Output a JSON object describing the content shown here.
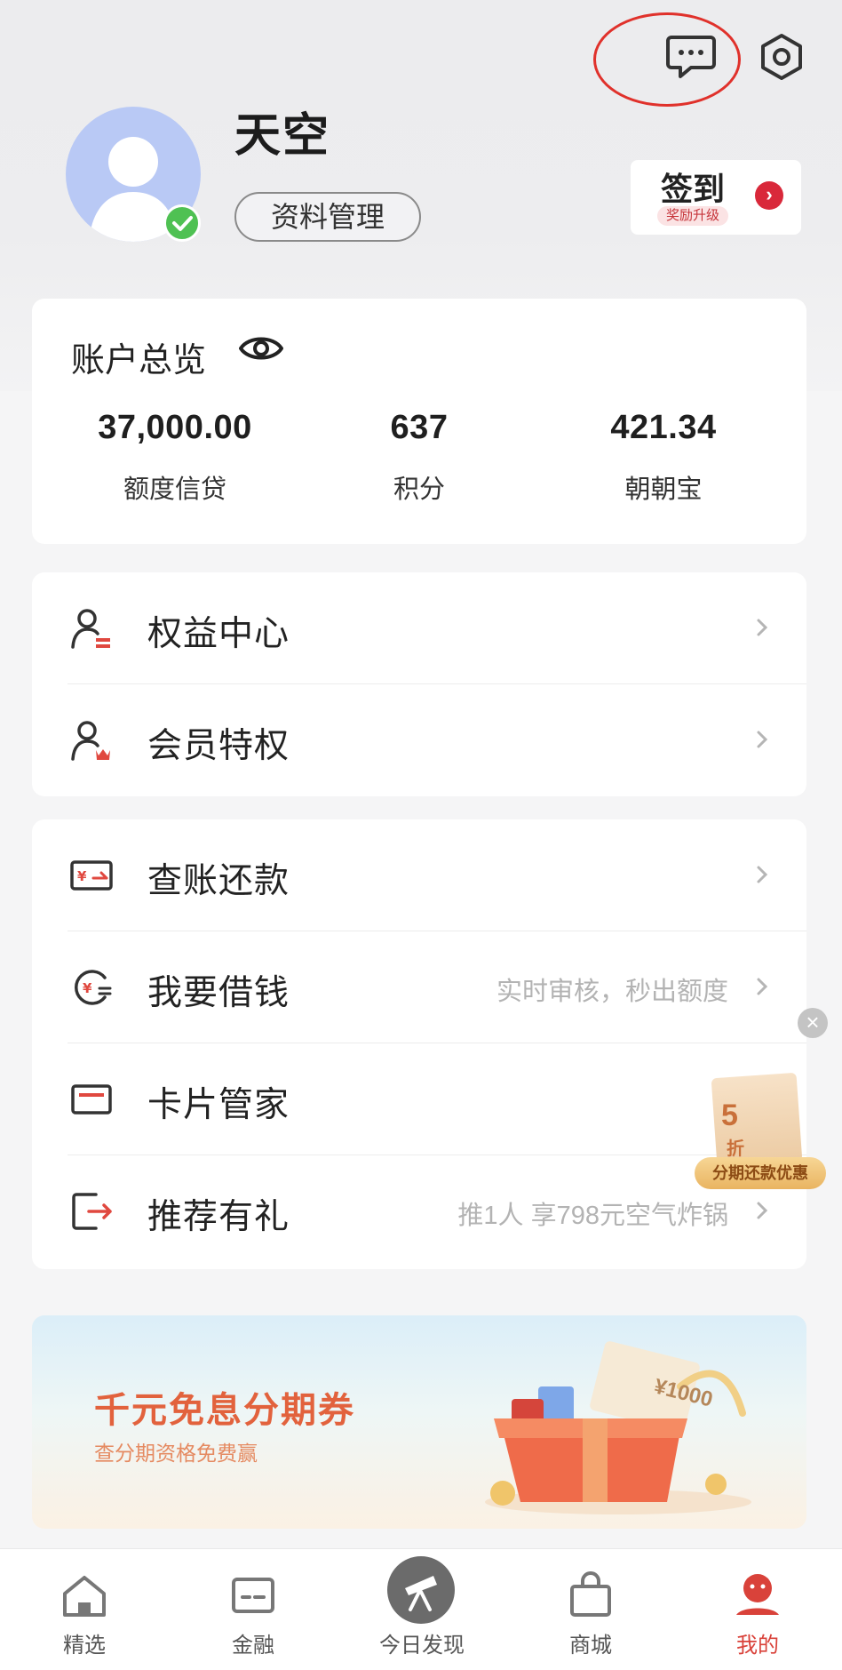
{
  "header": {
    "username": "天空",
    "profile_button": "资料管理",
    "checkin": {
      "title": "签到",
      "badge": "奖励升级"
    }
  },
  "overview": {
    "title": "账户总览",
    "stats": [
      {
        "value": "37,000.00",
        "label": "额度信贷"
      },
      {
        "value": "637",
        "label": "积分"
      },
      {
        "value": "421.34",
        "label": "朝朝宝"
      }
    ]
  },
  "group1": [
    {
      "label": "权益中心",
      "icon": "user-badge-icon",
      "hint": ""
    },
    {
      "label": "会员特权",
      "icon": "user-crown-icon",
      "hint": ""
    }
  ],
  "group2": [
    {
      "label": "查账还款",
      "icon": "bill-icon",
      "hint": ""
    },
    {
      "label": "我要借钱",
      "icon": "loan-icon",
      "hint": "实时审核，秒出额度"
    },
    {
      "label": "卡片管家",
      "icon": "card-icon",
      "hint": ""
    },
    {
      "label": "推荐有礼",
      "icon": "share-icon",
      "hint": "推1人 享798元空气炸锅"
    }
  ],
  "floating_promo": {
    "number": "5",
    "unit": "折",
    "label": "分期还款优惠"
  },
  "banner": {
    "title": "千元免息分期券",
    "subtitle": "查分期资格免费赢",
    "coupon": "¥1000"
  },
  "tabs": [
    {
      "label": "精选",
      "icon": "home-icon"
    },
    {
      "label": "金融",
      "icon": "wallet-icon"
    },
    {
      "label": "今日发现",
      "icon": "telescope-icon"
    },
    {
      "label": "商城",
      "icon": "shopping-bag-icon"
    },
    {
      "label": "我的",
      "icon": "profile-face-icon",
      "active": true
    }
  ],
  "colors": {
    "accent": "#d9423a",
    "annotation": "#e0312b",
    "avatar_bg": "#b9c9f5",
    "verified": "#4fc153"
  }
}
